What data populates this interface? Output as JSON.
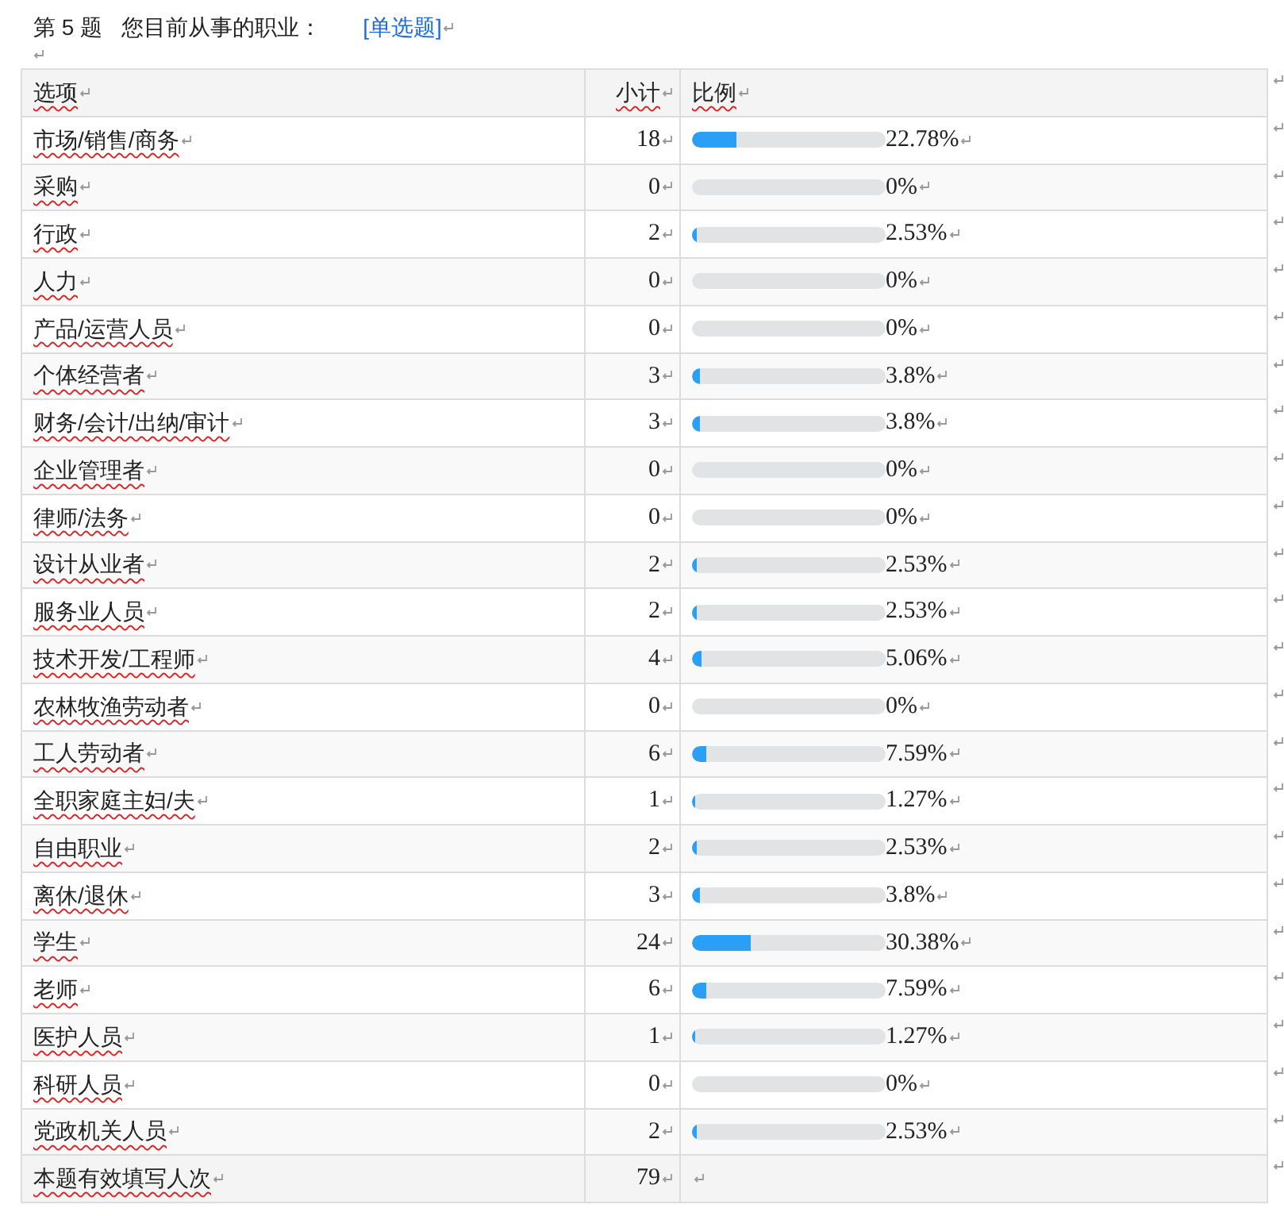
{
  "question": {
    "number_label": "第 5 题",
    "text": "您目前从事的职业：",
    "type": "[单选题]"
  },
  "table": {
    "columns": [
      "选项",
      "小计",
      "比例"
    ],
    "rows": [
      {
        "option": "市场/销售/商务",
        "count": "18",
        "percent": "22.78%",
        "level": 0.2278
      },
      {
        "option": "采购",
        "count": "0",
        "percent": "0%",
        "level": 0
      },
      {
        "option": "行政",
        "count": "2",
        "percent": "2.53%",
        "level": 0.0253
      },
      {
        "option": "人力",
        "count": "0",
        "percent": "0%",
        "level": 0
      },
      {
        "option": "产品/运营人员",
        "count": "0",
        "percent": "0%",
        "level": 0
      },
      {
        "option": "个体经营者",
        "count": "3",
        "percent": "3.8%",
        "level": 0.038
      },
      {
        "option": "财务/会计/出纳/审计",
        "count": "3",
        "percent": "3.8%",
        "level": 0.038
      },
      {
        "option": "企业管理者",
        "count": "0",
        "percent": "0%",
        "level": 0
      },
      {
        "option": "律师/法务",
        "count": "0",
        "percent": "0%",
        "level": 0
      },
      {
        "option": "设计从业者",
        "count": "2",
        "percent": "2.53%",
        "level": 0.0253
      },
      {
        "option": "服务业人员",
        "count": "2",
        "percent": "2.53%",
        "level": 0.0253
      },
      {
        "option": "技术开发/工程师",
        "count": "4",
        "percent": "5.06%",
        "level": 0.0506
      },
      {
        "option": "农林牧渔劳动者",
        "count": "0",
        "percent": "0%",
        "level": 0
      },
      {
        "option": "工人劳动者",
        "count": "6",
        "percent": "7.59%",
        "level": 0.0759
      },
      {
        "option": "全职家庭主妇/夫",
        "count": "1",
        "percent": "1.27%",
        "level": 0.0127
      },
      {
        "option": "自由职业",
        "count": "2",
        "percent": "2.53%",
        "level": 0.0253
      },
      {
        "option": "离休/退休",
        "count": "3",
        "percent": "3.8%",
        "level": 0.038
      },
      {
        "option": "学生",
        "count": "24",
        "percent": "30.38%",
        "level": 0.3038
      },
      {
        "option": "老师",
        "count": "6",
        "percent": "7.59%",
        "level": 0.0759
      },
      {
        "option": "医护人员",
        "count": "1",
        "percent": "1.27%",
        "level": 0.0127
      },
      {
        "option": "科研人员",
        "count": "0",
        "percent": "0%",
        "level": 0
      },
      {
        "option": "党政机关人员",
        "count": "2",
        "percent": "2.53%",
        "level": 0.0253
      }
    ],
    "total": {
      "label": "本题有效填写人次",
      "count": "79"
    }
  }
}
